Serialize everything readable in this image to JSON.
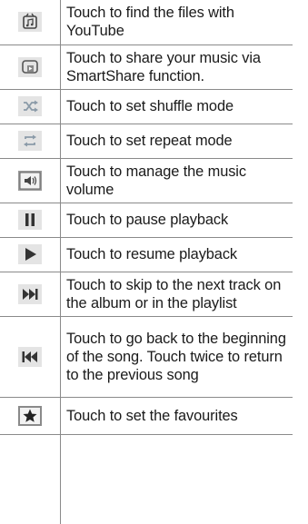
{
  "rows": [
    {
      "icon": "youtube-icon",
      "text": "Touch to find the files with YouTube"
    },
    {
      "icon": "smartshare-icon",
      "text": "Touch to share your music via SmartShare function."
    },
    {
      "icon": "shuffle-icon",
      "text": "Touch to set shuffle mode"
    },
    {
      "icon": "repeat-icon",
      "text": "Touch to set repeat mode"
    },
    {
      "icon": "volume-icon",
      "text": "Touch to manage the music volume"
    },
    {
      "icon": "pause-icon",
      "text": "Touch to pause playback"
    },
    {
      "icon": "play-icon",
      "text": "Touch to resume playback"
    },
    {
      "icon": "next-track-icon",
      "text": "Touch to skip to the next track on the album or in the playlist"
    },
    {
      "icon": "previous-track-icon",
      "text": "Touch to go back to the beginning of the song. Touch twice to return to the previous song"
    },
    {
      "icon": "favourite-star-icon",
      "text": "Touch to set the favourites"
    }
  ]
}
